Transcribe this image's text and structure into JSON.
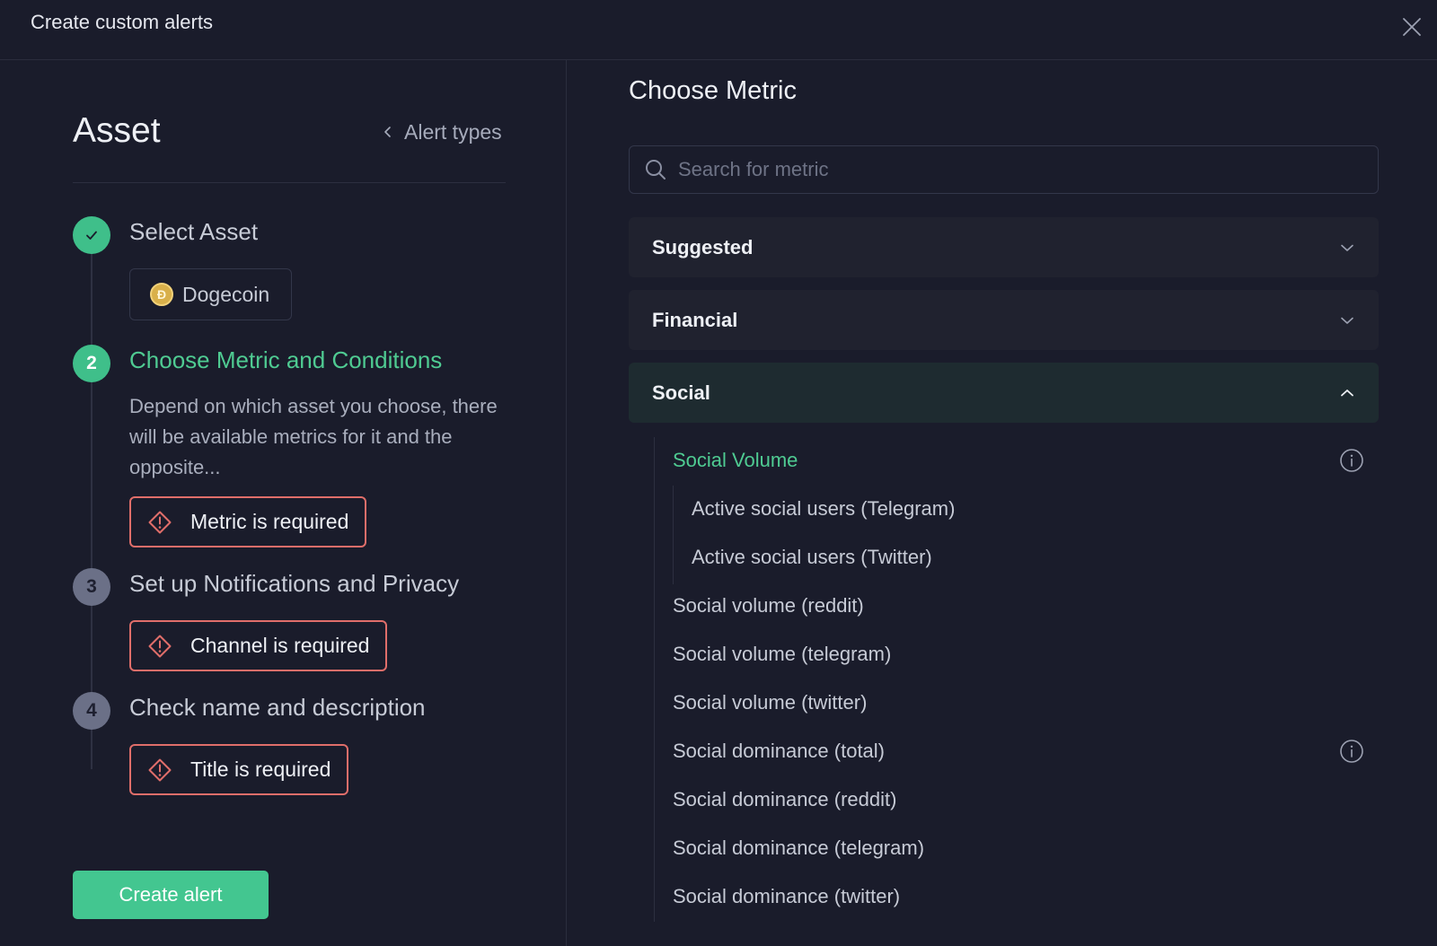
{
  "header": {
    "title": "Create custom alerts"
  },
  "left": {
    "heading": "Asset",
    "back_link": "Alert types",
    "steps": [
      {
        "number": "",
        "status": "done",
        "title": "Select Asset"
      },
      {
        "number": "2",
        "status": "active",
        "title": "Choose Metric and Conditions"
      },
      {
        "number": "3",
        "status": "todo",
        "title": "Set up Notifications and Privacy"
      },
      {
        "number": "4",
        "status": "todo",
        "title": "Check name and description"
      }
    ],
    "asset_chip": {
      "icon": "dogecoin-icon",
      "label": "Dogecoin"
    },
    "step2_description": "Depend on which asset you choose, there will be available metrics for it and the opposite...",
    "errors": {
      "metric": "Metric is required",
      "channel": "Channel is required",
      "title": "Title is required"
    },
    "create_button": "Create alert"
  },
  "right": {
    "heading": "Choose Metric",
    "search_placeholder": "Search for metric",
    "categories": [
      {
        "label": "Suggested",
        "expanded": false
      },
      {
        "label": "Financial",
        "expanded": false
      },
      {
        "label": "Social",
        "expanded": true
      }
    ],
    "social_metrics": [
      {
        "label": "Social Volume",
        "selected": true,
        "info": true
      },
      {
        "label": "Active social users (Telegram)",
        "sub": true
      },
      {
        "label": "Active social users (Twitter)",
        "sub": true
      },
      {
        "label": "Social volume (reddit)"
      },
      {
        "label": "Social volume (telegram)"
      },
      {
        "label": "Social volume (twitter)"
      },
      {
        "label": "Social dominance (total)",
        "info": true
      },
      {
        "label": "Social dominance (reddit)"
      },
      {
        "label": "Social dominance (telegram)"
      },
      {
        "label": "Social dominance (twitter)"
      }
    ]
  },
  "colors": {
    "background": "#1a1c2b",
    "accent_green": "#43c690",
    "error_red": "#e06e6a",
    "selected_text": "#4fcb92"
  }
}
